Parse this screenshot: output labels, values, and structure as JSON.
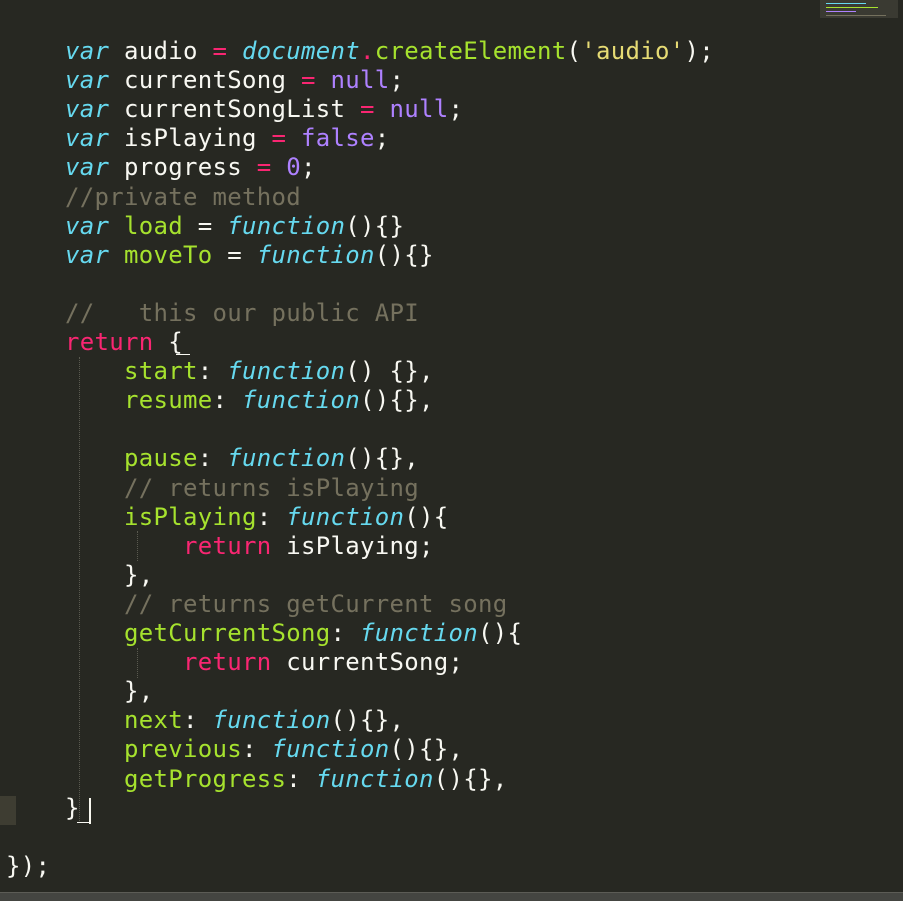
{
  "colors": {
    "background": "#272822",
    "keyword": "#66D9EF",
    "return": "#F92672",
    "constant": "#AE81FF",
    "string": "#E6DB74",
    "function_name": "#A6E22E",
    "comment": "#75715E",
    "plain": "#F8F8F2"
  },
  "editor": {
    "lines": [
      [
        {
          "t": "    ",
          "c": "plain"
        },
        {
          "t": "var",
          "c": "kw-storage"
        },
        {
          "t": " audio ",
          "c": "plain"
        },
        {
          "t": "=",
          "c": "op"
        },
        {
          "t": " ",
          "c": "plain"
        },
        {
          "t": "document",
          "c": "builtin"
        },
        {
          "t": ".",
          "c": "op"
        },
        {
          "t": "createElement",
          "c": "fname"
        },
        {
          "t": "(",
          "c": "plain"
        },
        {
          "t": "'audio'",
          "c": "str"
        },
        {
          "t": ");",
          "c": "plain"
        }
      ],
      [
        {
          "t": "    ",
          "c": "plain"
        },
        {
          "t": "var",
          "c": "kw-storage"
        },
        {
          "t": " currentSong ",
          "c": "plain"
        },
        {
          "t": "=",
          "c": "op"
        },
        {
          "t": " ",
          "c": "plain"
        },
        {
          "t": "null",
          "c": "const"
        },
        {
          "t": ";",
          "c": "plain"
        }
      ],
      [
        {
          "t": "    ",
          "c": "plain"
        },
        {
          "t": "var",
          "c": "kw-storage"
        },
        {
          "t": " currentSongList ",
          "c": "plain"
        },
        {
          "t": "=",
          "c": "op"
        },
        {
          "t": " ",
          "c": "plain"
        },
        {
          "t": "null",
          "c": "const"
        },
        {
          "t": ";",
          "c": "plain"
        }
      ],
      [
        {
          "t": "    ",
          "c": "plain"
        },
        {
          "t": "var",
          "c": "kw-storage"
        },
        {
          "t": " isPlaying ",
          "c": "plain"
        },
        {
          "t": "=",
          "c": "op"
        },
        {
          "t": " ",
          "c": "plain"
        },
        {
          "t": "false",
          "c": "const"
        },
        {
          "t": ";",
          "c": "plain"
        }
      ],
      [
        {
          "t": "    ",
          "c": "plain"
        },
        {
          "t": "var",
          "c": "kw-storage"
        },
        {
          "t": " progress ",
          "c": "plain"
        },
        {
          "t": "=",
          "c": "op"
        },
        {
          "t": " ",
          "c": "plain"
        },
        {
          "t": "0",
          "c": "const"
        },
        {
          "t": ";",
          "c": "plain"
        }
      ],
      [
        {
          "t": "    ",
          "c": "plain"
        },
        {
          "t": "//private method",
          "c": "comment"
        }
      ],
      [
        {
          "t": "    ",
          "c": "plain"
        },
        {
          "t": "var",
          "c": "kw-storage"
        },
        {
          "t": " ",
          "c": "plain"
        },
        {
          "t": "load",
          "c": "fname"
        },
        {
          "t": " = ",
          "c": "plain"
        },
        {
          "t": "function",
          "c": "kw-func"
        },
        {
          "t": "(){}",
          "c": "plain"
        }
      ],
      [
        {
          "t": "    ",
          "c": "plain"
        },
        {
          "t": "var",
          "c": "kw-storage"
        },
        {
          "t": " ",
          "c": "plain"
        },
        {
          "t": "moveTo",
          "c": "fname"
        },
        {
          "t": " = ",
          "c": "plain"
        },
        {
          "t": "function",
          "c": "kw-func"
        },
        {
          "t": "(){}",
          "c": "plain"
        }
      ],
      [],
      [
        {
          "t": "    ",
          "c": "plain"
        },
        {
          "t": "//   this our public API",
          "c": "comment"
        }
      ],
      [
        {
          "t": "    ",
          "c": "plain"
        },
        {
          "t": "return",
          "c": "kw-return"
        },
        {
          "t": " {",
          "c": "plain"
        }
      ],
      [
        {
          "t": "        ",
          "c": "plain"
        },
        {
          "t": "start",
          "c": "prop"
        },
        {
          "t": ": ",
          "c": "plain"
        },
        {
          "t": "function",
          "c": "kw-func"
        },
        {
          "t": "() {},",
          "c": "plain"
        }
      ],
      [
        {
          "t": "        ",
          "c": "plain"
        },
        {
          "t": "resume",
          "c": "prop"
        },
        {
          "t": ": ",
          "c": "plain"
        },
        {
          "t": "function",
          "c": "kw-func"
        },
        {
          "t": "(){},",
          "c": "plain"
        }
      ],
      [],
      [
        {
          "t": "        ",
          "c": "plain"
        },
        {
          "t": "pause",
          "c": "prop"
        },
        {
          "t": ": ",
          "c": "plain"
        },
        {
          "t": "function",
          "c": "kw-func"
        },
        {
          "t": "(){},",
          "c": "plain"
        }
      ],
      [
        {
          "t": "        ",
          "c": "plain"
        },
        {
          "t": "// returns isPlaying",
          "c": "comment"
        }
      ],
      [
        {
          "t": "        ",
          "c": "plain"
        },
        {
          "t": "isPlaying",
          "c": "prop"
        },
        {
          "t": ": ",
          "c": "plain"
        },
        {
          "t": "function",
          "c": "kw-func"
        },
        {
          "t": "(){",
          "c": "plain"
        }
      ],
      [
        {
          "t": "            ",
          "c": "plain"
        },
        {
          "t": "return",
          "c": "kw-return"
        },
        {
          "t": " isPlaying;",
          "c": "plain"
        }
      ],
      [
        {
          "t": "        },",
          "c": "plain"
        }
      ],
      [
        {
          "t": "        ",
          "c": "plain"
        },
        {
          "t": "// returns getCurrent song",
          "c": "comment"
        }
      ],
      [
        {
          "t": "        ",
          "c": "plain"
        },
        {
          "t": "getCurrentSong",
          "c": "prop"
        },
        {
          "t": ": ",
          "c": "plain"
        },
        {
          "t": "function",
          "c": "kw-func"
        },
        {
          "t": "(){",
          "c": "plain"
        }
      ],
      [
        {
          "t": "            ",
          "c": "plain"
        },
        {
          "t": "return",
          "c": "kw-return"
        },
        {
          "t": " currentSong;",
          "c": "plain"
        }
      ],
      [
        {
          "t": "        },",
          "c": "plain"
        }
      ],
      [
        {
          "t": "        ",
          "c": "plain"
        },
        {
          "t": "next",
          "c": "prop"
        },
        {
          "t": ": ",
          "c": "plain"
        },
        {
          "t": "function",
          "c": "kw-func"
        },
        {
          "t": "(){},",
          "c": "plain"
        }
      ],
      [
        {
          "t": "        ",
          "c": "plain"
        },
        {
          "t": "previous",
          "c": "prop"
        },
        {
          "t": ": ",
          "c": "plain"
        },
        {
          "t": "function",
          "c": "kw-func"
        },
        {
          "t": "(){},",
          "c": "plain"
        }
      ],
      [
        {
          "t": "        ",
          "c": "plain"
        },
        {
          "t": "getProgress",
          "c": "prop"
        },
        {
          "t": ": ",
          "c": "plain"
        },
        {
          "t": "function",
          "c": "kw-func"
        },
        {
          "t": "(){},",
          "c": "plain"
        }
      ],
      [
        {
          "t": "    }",
          "c": "plain"
        }
      ],
      [],
      [
        {
          "t": "});",
          "c": "plain"
        }
      ]
    ]
  }
}
